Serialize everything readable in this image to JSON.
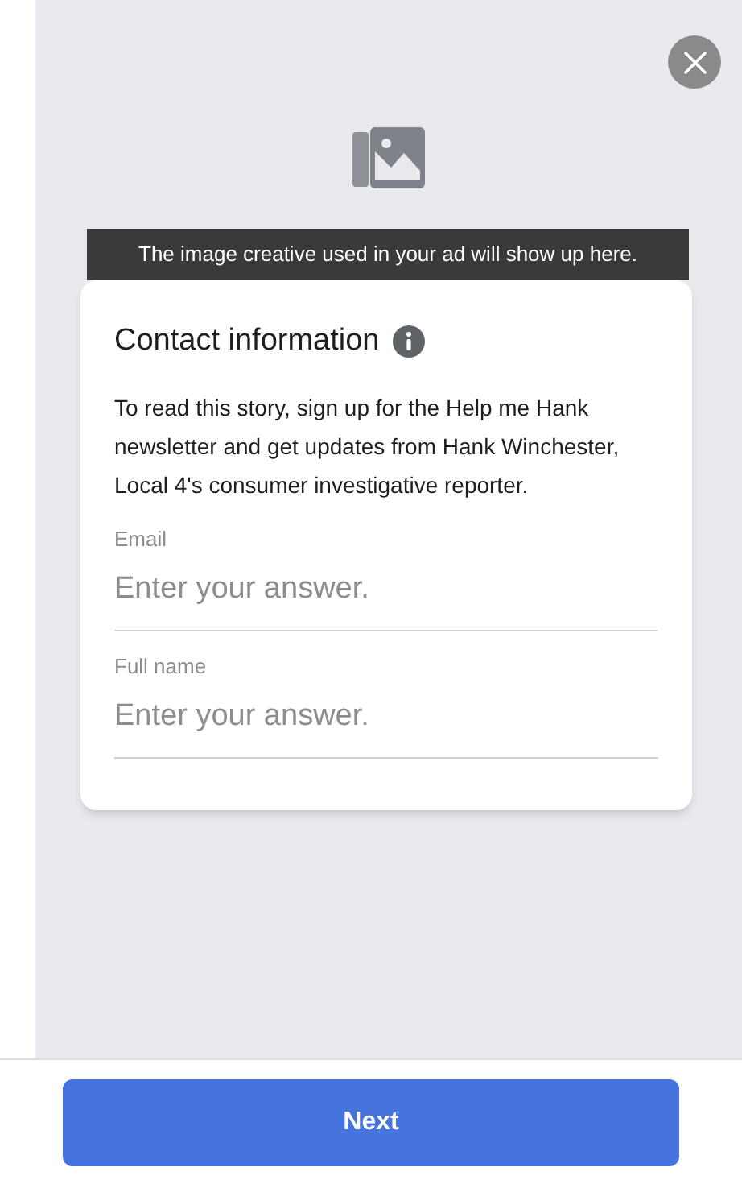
{
  "preview": {
    "caption": "The image creative used in your ad will show up here."
  },
  "form": {
    "title": "Contact information",
    "description": "To read this story, sign up for the Help me Hank newsletter and get updates from Hank Winchester, Local 4's consumer investigative reporter.",
    "fields": [
      {
        "label": "Email",
        "placeholder": "Enter your answer."
      },
      {
        "label": "Full name",
        "placeholder": "Enter your answer."
      }
    ]
  },
  "next_button": "Next"
}
